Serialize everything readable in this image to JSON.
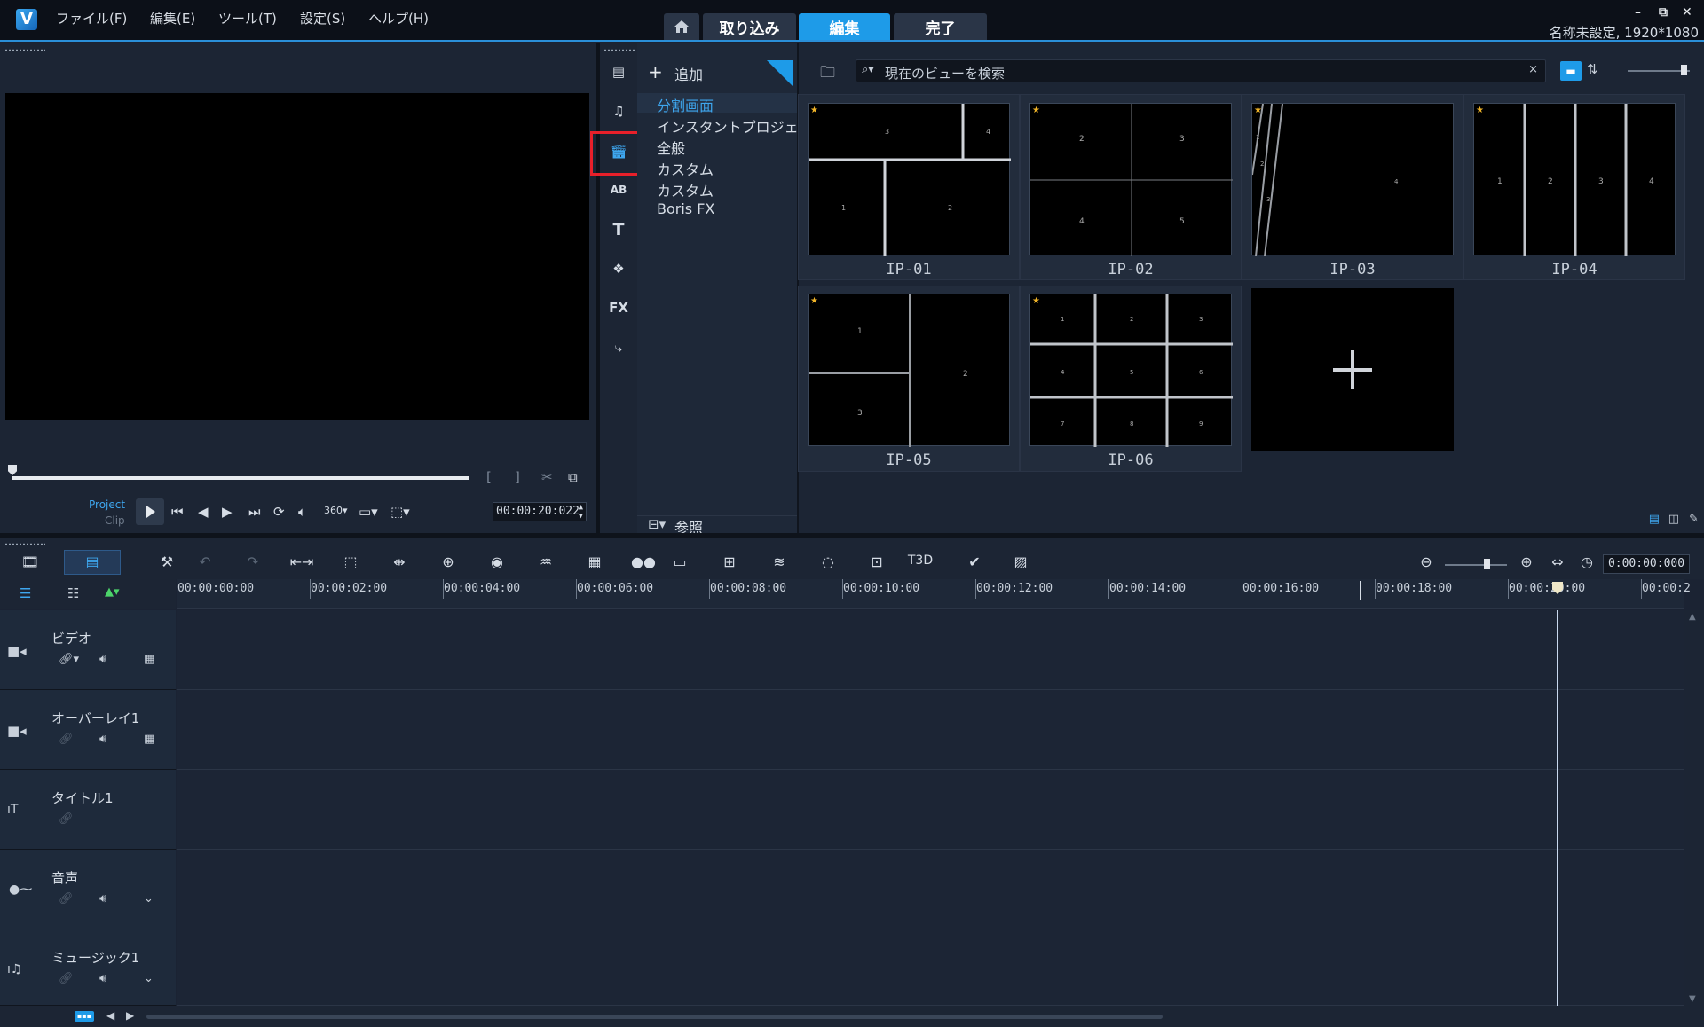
{
  "app": {
    "logo_text": "V"
  },
  "menu": [
    "ファイル(F)",
    "編集(E)",
    "ツール(T)",
    "設定(S)",
    "ヘルプ(H)"
  ],
  "tabs": {
    "home_icon": "home-icon",
    "capture": "取り込み",
    "edit": "編集",
    "share": "完了"
  },
  "window": {
    "project_info": "名称未設定, 1920*1080",
    "minimize": "–",
    "restore": "⧉",
    "close": "✕"
  },
  "player": {
    "project_label": "Project",
    "clip_label": "Clip",
    "timecode": "00:00:20:022",
    "progress": 1.0
  },
  "library": {
    "add_label": "追加",
    "browse_label": "参照",
    "search_placeholder": "現在のビューを検索",
    "categories": [
      "分割画面",
      "インスタントプロジェクト",
      "全般",
      "カスタム",
      "カスタム",
      "Boris FX"
    ],
    "selected_category": "分割画面",
    "thumbnails": [
      "IP-01",
      "IP-02",
      "IP-03",
      "IP-04",
      "IP-05",
      "IP-06"
    ],
    "thumb_numbers": {
      "ip01": [
        "1",
        "2",
        "3",
        "4"
      ],
      "ip02": [
        "2",
        "3",
        "4",
        "5"
      ],
      "ip03": [
        "1",
        "2",
        "3",
        "4"
      ],
      "ip04": [
        "1",
        "2",
        "3",
        "4"
      ],
      "ip05": [
        "1",
        "2",
        "3"
      ],
      "ip06": [
        "1",
        "2",
        "3",
        "4",
        "5",
        "6",
        "7",
        "8",
        "9"
      ]
    }
  },
  "timeline": {
    "timecode": "0:00:00:000",
    "ruler": [
      "00:00:00:00",
      "00:00:02:00",
      "00:00:04:00",
      "00:00:06:00",
      "00:00:08:00",
      "00:00:10:00",
      "00:00:12:00",
      "00:00:14:00",
      "00:00:16:00",
      "00:00:18:00",
      "00:00:20:00",
      "00:00:2"
    ],
    "tracks": [
      {
        "name": "ビデオ"
      },
      {
        "name": "オーバーレイ1"
      },
      {
        "name": "タイトル1"
      },
      {
        "name": "音声"
      },
      {
        "name": "ミュージック1"
      }
    ]
  },
  "colors": {
    "accent": "#1e9be8",
    "highlight_box": "#e8202a",
    "background": "#1b2333"
  }
}
